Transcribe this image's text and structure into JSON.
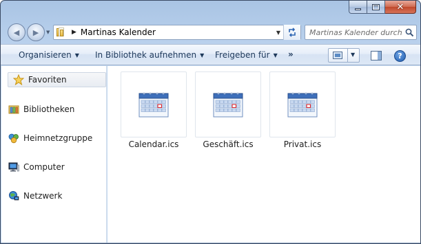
{
  "window": {
    "min_label": "",
    "max_label": "",
    "close_glyph": "✕"
  },
  "nav": {
    "back_glyph": "◀",
    "forward_glyph": "▶",
    "dropdown_glyph": "▼"
  },
  "address": {
    "arrow": "▶",
    "path": "Martinas Kalender",
    "dropdown_glyph": "▼"
  },
  "search": {
    "placeholder": "Martinas Kalender durchsuchen"
  },
  "commands": {
    "organize": "Organisieren",
    "include_library": "In Bibliothek aufnehmen",
    "share": "Freigeben für",
    "more": "»",
    "caret": "▼",
    "help": "?"
  },
  "sidebar": {
    "items": [
      {
        "label": "Favoriten",
        "icon": "star-icon"
      },
      {
        "label": "Bibliotheken",
        "icon": "library-icon"
      },
      {
        "label": "Heimnetzgruppe",
        "icon": "homegroup-icon"
      },
      {
        "label": "Computer",
        "icon": "computer-icon"
      },
      {
        "label": "Netzwerk",
        "icon": "network-icon"
      }
    ]
  },
  "files": [
    {
      "name": "Calendar.ics",
      "icon": "calendar-file-icon"
    },
    {
      "name": "Geschäft.ics",
      "icon": "calendar-file-icon"
    },
    {
      "name": "Privat.ics",
      "icon": "calendar-file-icon"
    }
  ],
  "colors": {
    "accent": "#1e395b",
    "frame": "#bcd3ee",
    "close": "#c0482b"
  }
}
